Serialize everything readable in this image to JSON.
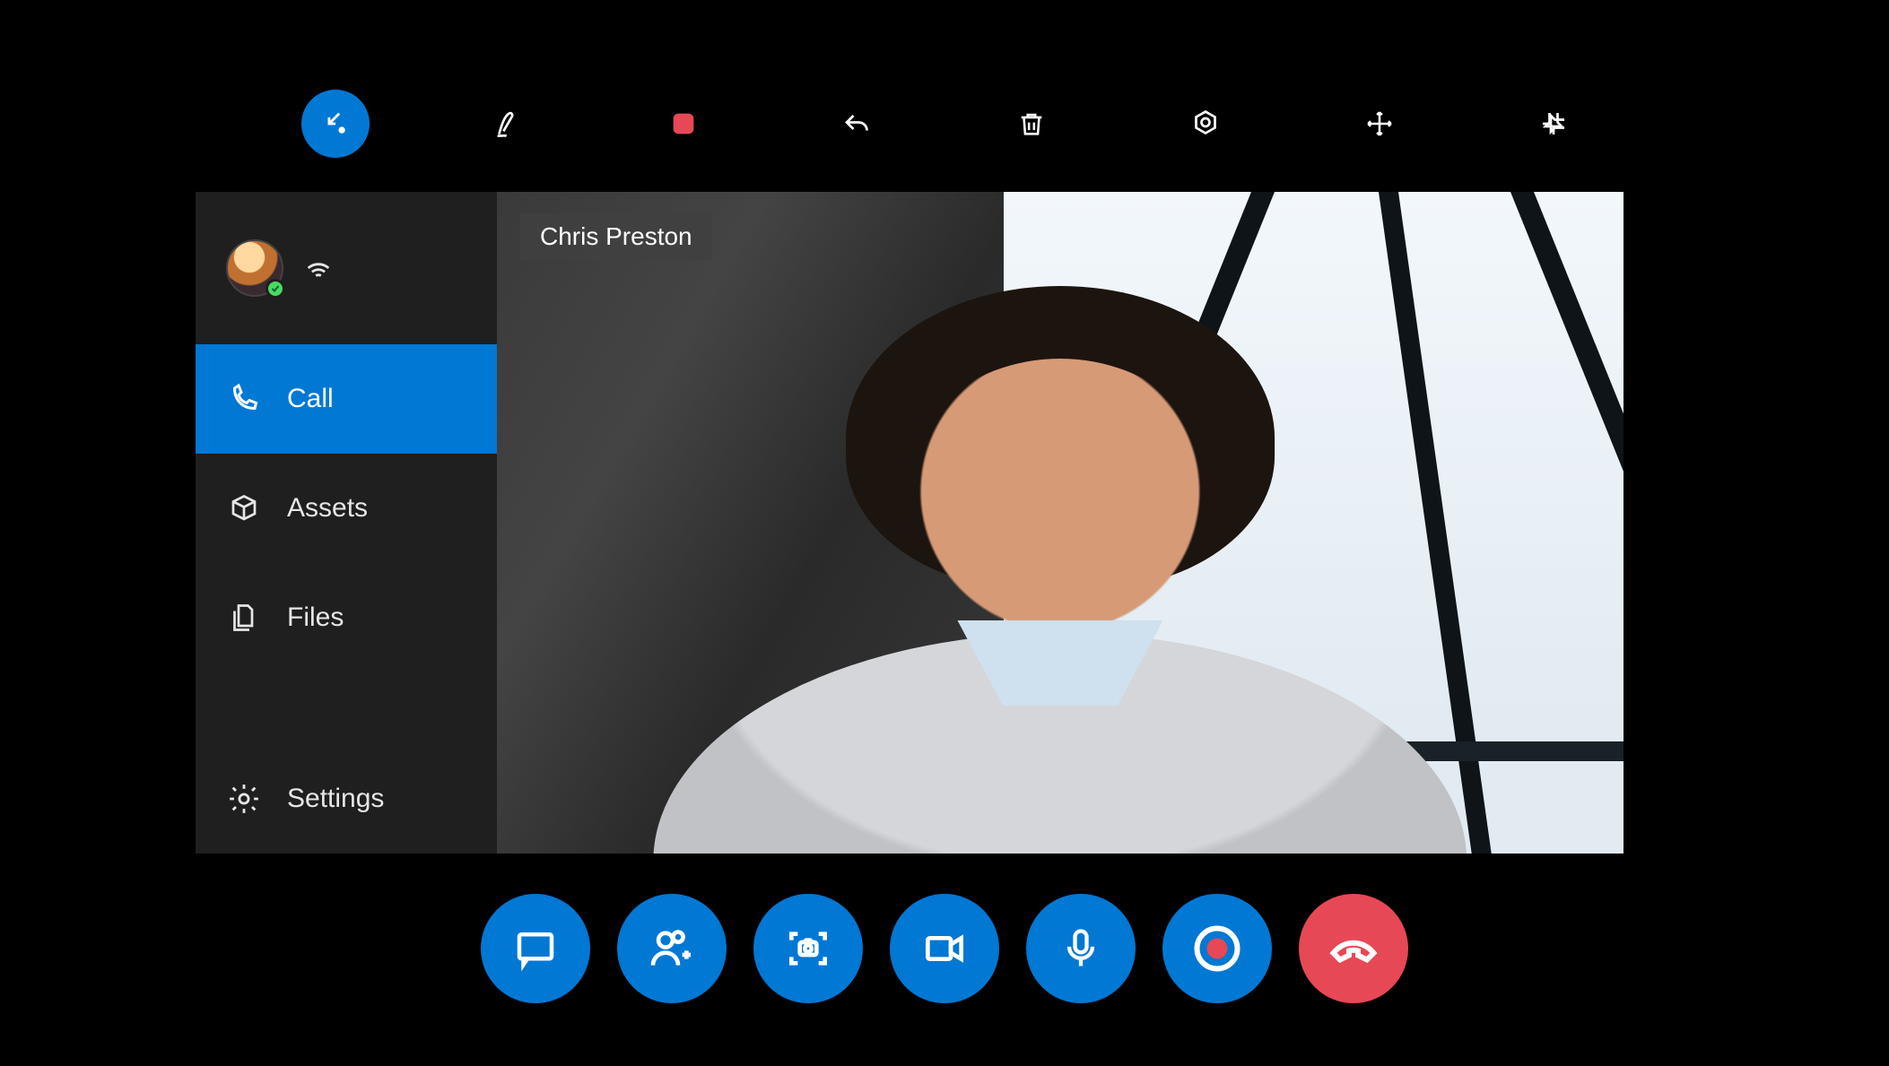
{
  "colors": {
    "primary": "#0078D4",
    "danger": "#E74856",
    "background": "#000000",
    "panel": "#1f1f1f"
  },
  "top_tools": {
    "collapse": "collapse",
    "ink": "ink",
    "stop": "stop-recording",
    "undo": "undo",
    "delete": "delete",
    "annotate_shape": "annotate-shape",
    "move": "move",
    "pin": "pin"
  },
  "user": {
    "presence": "available",
    "signal_icon": "wifi-icon"
  },
  "sidebar": {
    "items": [
      {
        "label": "Call",
        "icon": "phone-icon",
        "active": true
      },
      {
        "label": "Assets",
        "icon": "box-icon",
        "active": false
      },
      {
        "label": "Files",
        "icon": "files-icon",
        "active": false
      },
      {
        "label": "Settings",
        "icon": "gear-icon",
        "active": false
      }
    ]
  },
  "call": {
    "remote_name": "Chris Preston"
  },
  "controls": {
    "chat": "chat",
    "add_participant": "add-participant",
    "capture": "capture",
    "video": "video",
    "mic": "microphone",
    "record": "record",
    "hangup": "hang-up"
  }
}
